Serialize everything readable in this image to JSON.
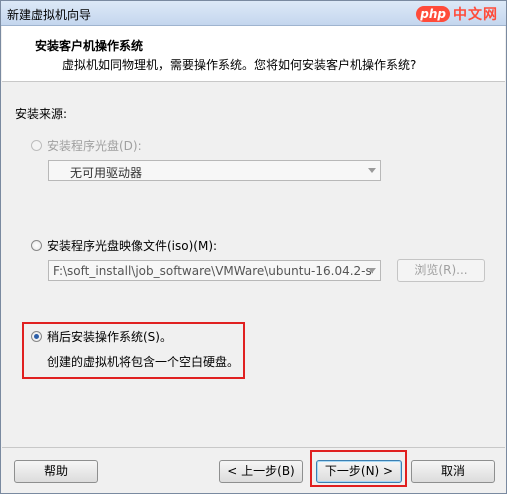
{
  "window": {
    "title": "新建虚拟机向导"
  },
  "watermark": {
    "badge": "php",
    "text": "中文网"
  },
  "header": {
    "title": "安装客户机操作系统",
    "subtitle": "虚拟机如同物理机，需要操作系统。您将如何安装客户机操作系统?"
  },
  "source": {
    "label": "安装来源:",
    "disc": {
      "label": "安装程序光盘(D):",
      "selected": "无可用驱动器"
    },
    "iso": {
      "label": "安装程序光盘映像文件(iso)(M):",
      "path": "F:\\soft_install\\job_software\\VMWare\\ubuntu-16.04.2-se",
      "browse": "浏览(R)..."
    },
    "later": {
      "label": "稍后安装操作系统(S)。",
      "description": "创建的虚拟机将包含一个空白硬盘。"
    }
  },
  "buttons": {
    "help": "帮助",
    "back": "< 上一步(B)",
    "next": "下一步(N) >",
    "cancel": "取消"
  },
  "colors": {
    "highlight_box": "#e02020",
    "accent": "#2d5fa8"
  }
}
